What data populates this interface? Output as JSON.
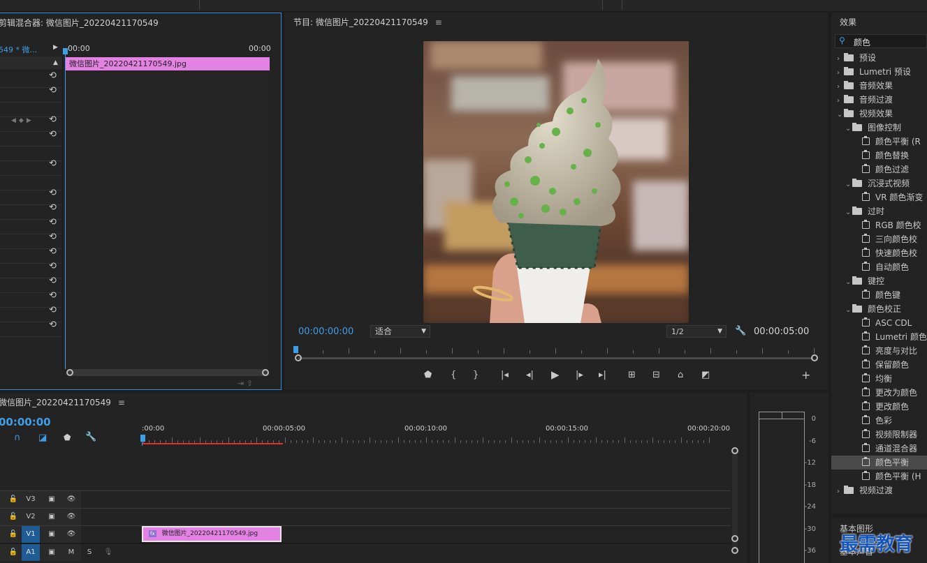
{
  "source_panel": {
    "title": "剪辑混合器: 微信图片_20220421170549",
    "clip_tab": "549 * 微...",
    "time_start": "00:00",
    "time_end": "00:00",
    "clip_name": "微信图片_20220421170549.jpg"
  },
  "program_panel": {
    "title": "节目: 微信图片_20220421170549",
    "current_time": "00:00:00:00",
    "fit_label": "适合",
    "resolution_label": "1/2",
    "duration": "00:00:05:00"
  },
  "timeline": {
    "title": "微信图片_20220421170549",
    "current_time": "00:00:00",
    "ruler": [
      ":00:00",
      "00:00:05:00",
      "00:00:10:00",
      "00:00:15:00",
      "00:00:20:00"
    ],
    "tracks": [
      {
        "name": "V3",
        "lock": "🔒"
      },
      {
        "name": "V2"
      },
      {
        "name": "V1"
      },
      {
        "name": "A1",
        "m": "M",
        "s": "S"
      }
    ],
    "clip_badge": "fx",
    "clip_name": "微信图片_20220421170549.jpg"
  },
  "meter": {
    "scale": [
      "0",
      "-6",
      "-12",
      "-18",
      "-24",
      "-30",
      "-36"
    ]
  },
  "effects": {
    "title": "效果",
    "search_value": "颜色",
    "tree": [
      {
        "label": "预设",
        "level": 0,
        "kind": "bin",
        "open": false
      },
      {
        "label": "Lumetri 预设",
        "level": 0,
        "kind": "bin",
        "open": false
      },
      {
        "label": "音频效果",
        "level": 0,
        "kind": "bin",
        "open": false
      },
      {
        "label": "音频过渡",
        "level": 0,
        "kind": "bin",
        "open": false
      },
      {
        "label": "视频效果",
        "level": 0,
        "kind": "bin",
        "open": true
      },
      {
        "label": "图像控制",
        "level": 1,
        "kind": "bin",
        "open": true
      },
      {
        "label": "颜色平衡 (R",
        "level": 2,
        "kind": "fx"
      },
      {
        "label": "颜色替换",
        "level": 2,
        "kind": "fx"
      },
      {
        "label": "颜色过滤",
        "level": 2,
        "kind": "fx"
      },
      {
        "label": "沉浸式视频",
        "level": 1,
        "kind": "bin",
        "open": true
      },
      {
        "label": "VR 颜色渐变",
        "level": 2,
        "kind": "fx"
      },
      {
        "label": "过时",
        "level": 1,
        "kind": "bin",
        "open": true
      },
      {
        "label": "RGB 颜色校",
        "level": 2,
        "kind": "fx"
      },
      {
        "label": "三向颜色校",
        "level": 2,
        "kind": "fx"
      },
      {
        "label": "快速颜色校",
        "level": 2,
        "kind": "fx"
      },
      {
        "label": "自动颜色",
        "level": 2,
        "kind": "fx"
      },
      {
        "label": "键控",
        "level": 1,
        "kind": "bin",
        "open": true
      },
      {
        "label": "颜色键",
        "level": 2,
        "kind": "fx"
      },
      {
        "label": "颜色校正",
        "level": 1,
        "kind": "bin",
        "open": true
      },
      {
        "label": "ASC CDL",
        "level": 2,
        "kind": "fx"
      },
      {
        "label": "Lumetri 颜色",
        "level": 2,
        "kind": "fx"
      },
      {
        "label": "亮度与对比",
        "level": 2,
        "kind": "fx"
      },
      {
        "label": "保留颜色",
        "level": 2,
        "kind": "fx"
      },
      {
        "label": "均衡",
        "level": 2,
        "kind": "fx"
      },
      {
        "label": "更改为颜色",
        "level": 2,
        "kind": "fx"
      },
      {
        "label": "更改颜色",
        "level": 2,
        "kind": "fx"
      },
      {
        "label": "色彩",
        "level": 2,
        "kind": "fx"
      },
      {
        "label": "视频限制器",
        "level": 2,
        "kind": "fx"
      },
      {
        "label": "通道混合器",
        "level": 2,
        "kind": "fx"
      },
      {
        "label": "颜色平衡",
        "level": 2,
        "kind": "fx",
        "selected": true
      },
      {
        "label": "颜色平衡 (H",
        "level": 2,
        "kind": "fx"
      },
      {
        "label": "视频过渡",
        "level": 0,
        "kind": "bin",
        "open": false
      }
    ],
    "bottom_label": "基本图形",
    "bottom_label2": "基本声音"
  },
  "watermark": "最需教育",
  "colors": {
    "accent": "#3f9ee8",
    "clip": "#e382e3",
    "playhead_red": "#e0302f"
  }
}
